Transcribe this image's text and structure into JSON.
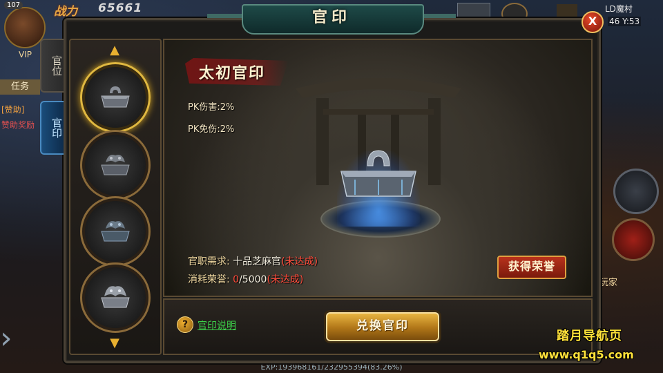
{
  "hud": {
    "level": "107",
    "power_label": "战力",
    "power_value": "65661",
    "vip": "VIP",
    "task_tab": "任务",
    "help_tag": "[赞助]",
    "help_tag2": "赞助奖励",
    "map_name": "LD魔村",
    "coords": "46 Y:53",
    "player_label": "玩家",
    "exp": "EXP:193968161/232955394(83.26%)"
  },
  "dialog": {
    "title": "官印",
    "close_label": "X",
    "tabs": [
      {
        "label": "官位",
        "active": false
      },
      {
        "label": "官印",
        "active": true
      }
    ],
    "scroll_up": "▲",
    "scroll_down": "▼",
    "seals": [
      {
        "name": "seal-1",
        "selected": true
      },
      {
        "name": "seal-2",
        "selected": false
      },
      {
        "name": "seal-3",
        "selected": false
      },
      {
        "name": "seal-4",
        "selected": false
      }
    ],
    "seal_title": "太初官印",
    "stats": [
      "PK伤害:2%",
      "PK免伤:2%"
    ],
    "requirement": {
      "label": "官职需求:",
      "value": "十品芝麻官",
      "status": "(未达成)"
    },
    "cost": {
      "label": "消耗荣誉:",
      "current": "0",
      "total": "/5000",
      "status": "(未达成)"
    },
    "honor_button": "获得荣誉",
    "help_icon": "?",
    "help_link": "官印说明",
    "exchange_button": "兑换官印"
  },
  "watermark": {
    "line1": "踏月导航页",
    "line2": "www.q1q5.com"
  },
  "colors": {
    "accent_gold": "#e0b840",
    "status_red": "#ff4a3a",
    "link_green": "#3cd04a"
  }
}
